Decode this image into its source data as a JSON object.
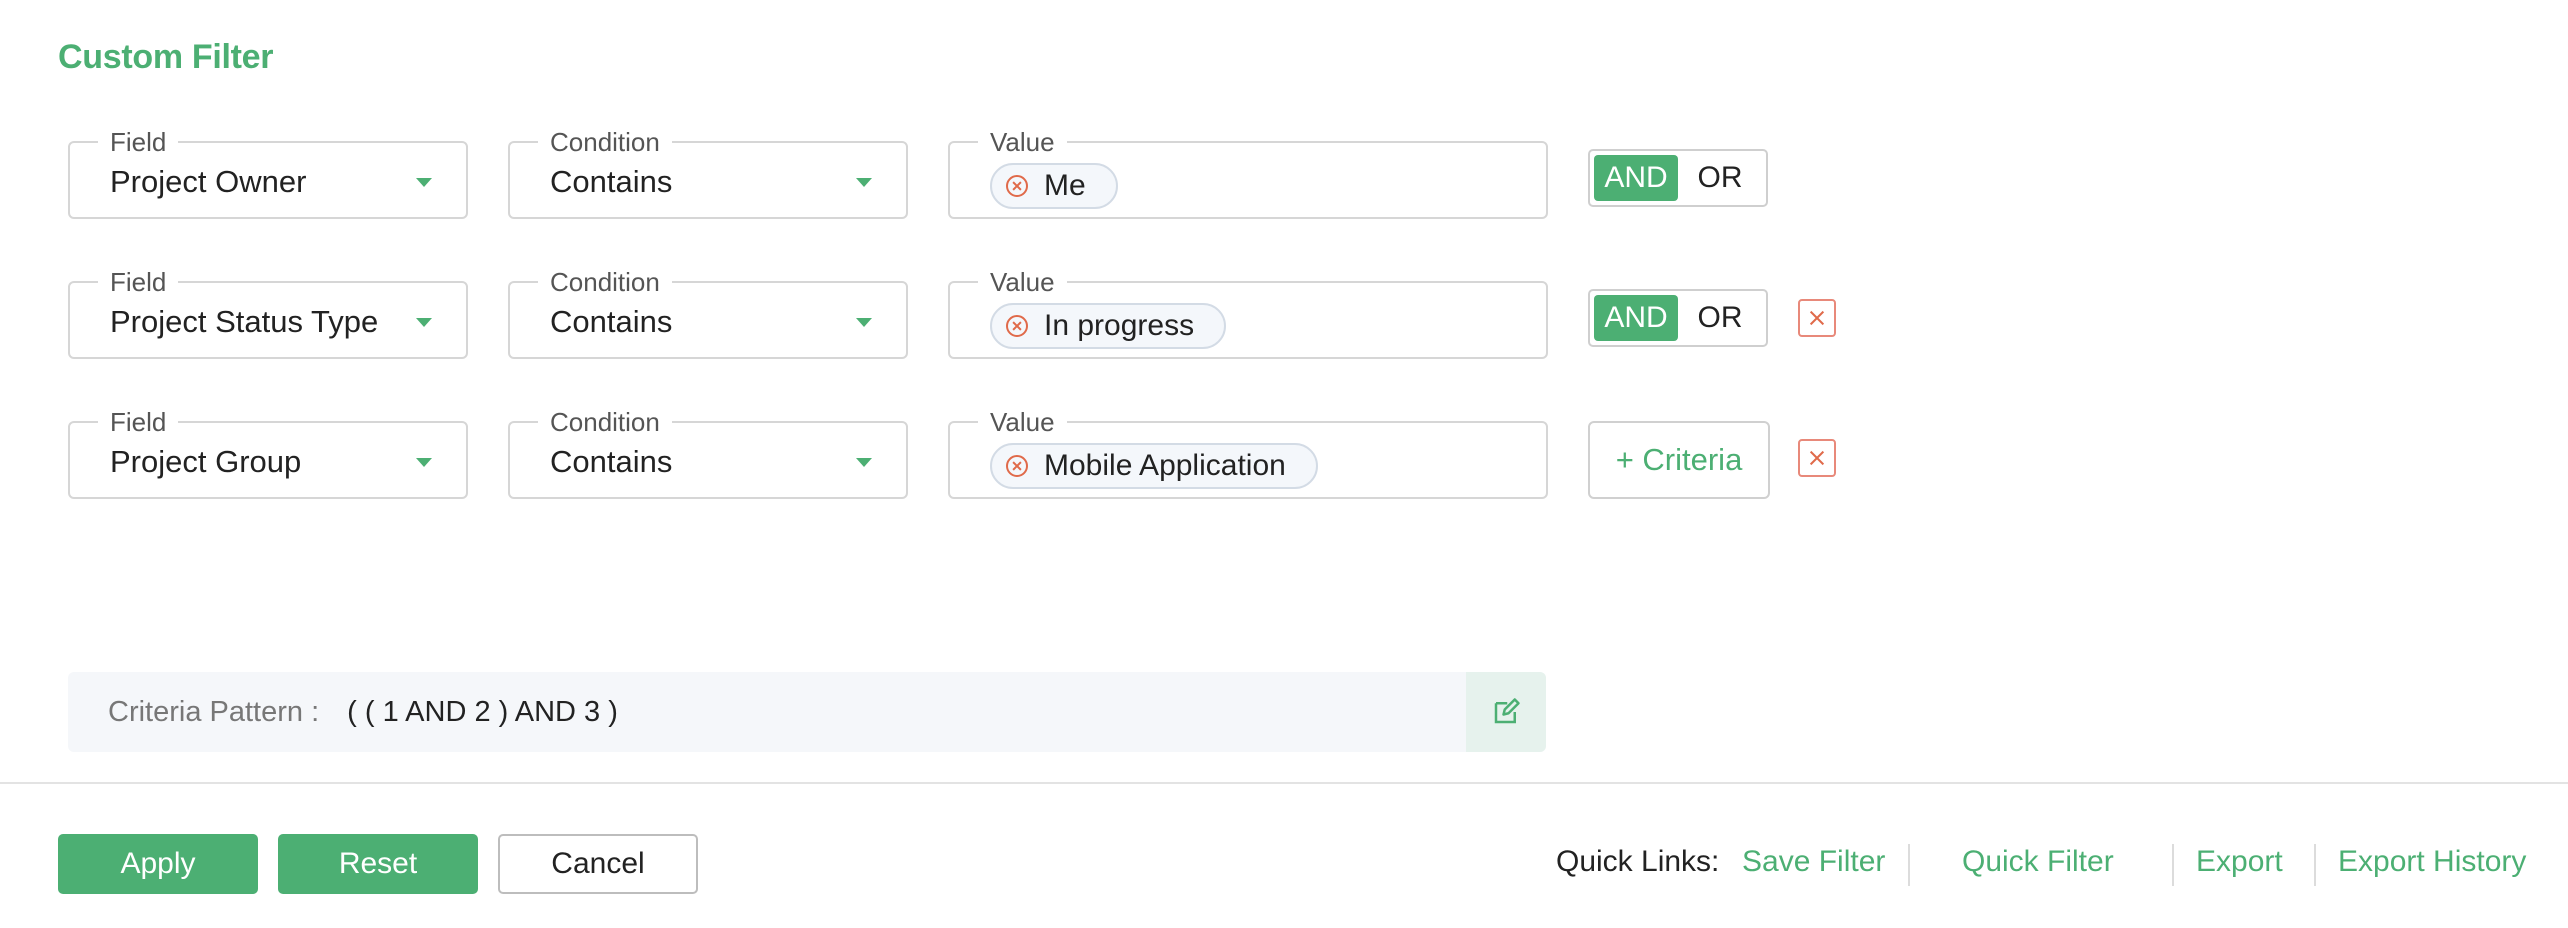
{
  "title": "Custom Filter",
  "labels": {
    "field": "Field",
    "condition": "Condition",
    "value": "Value"
  },
  "rows": [
    {
      "field": "Project Owner",
      "condition": "Contains",
      "value": "Me",
      "and": "AND",
      "or": "OR"
    },
    {
      "field": "Project Status Type",
      "condition": "Contains",
      "value": "In progress",
      "and": "AND",
      "or": "OR"
    },
    {
      "field": "Project Group",
      "condition": "Contains",
      "value": "Mobile Application",
      "add_criteria": "+ Criteria"
    }
  ],
  "criteria_pattern": {
    "label": "Criteria Pattern :",
    "value": "( ( 1 AND 2 ) AND 3 )"
  },
  "buttons": {
    "apply": "Apply",
    "reset": "Reset",
    "cancel": "Cancel"
  },
  "quick_links": {
    "label": "Quick Links:",
    "items": [
      "Save Filter",
      "Quick Filter",
      "Export",
      "Export History"
    ]
  },
  "colors": {
    "accent": "#4caf73",
    "danger": "#e06a4a"
  },
  "icons": {
    "caret": "caret-down-icon",
    "remove": "remove-circle-icon",
    "delete": "close-icon",
    "edit": "edit-icon"
  }
}
